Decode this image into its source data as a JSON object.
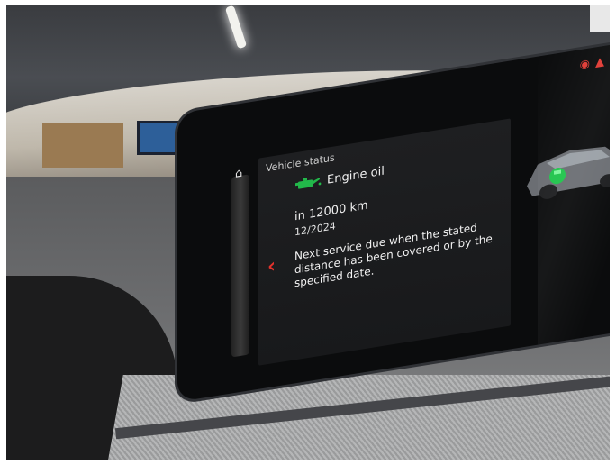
{
  "display": {
    "screen_title": "Vehicle status",
    "home_icon": "home-icon",
    "status_icons": [
      "tire-pressure-icon",
      "warning-icon"
    ],
    "section": {
      "icon": "engine-oil-icon",
      "label": "Engine oil"
    },
    "service": {
      "distance": "in 12000 km",
      "date": "12/2024",
      "description": "Next service due when the stated distance has been covered or by the specified date."
    },
    "back_icon": "back-arrow-icon",
    "vehicle_icon": "car-with-engine-highlight-icon"
  },
  "colors": {
    "accent_red": "#e3322c",
    "oil_green": "#22b84a",
    "text": "#f0f0f0"
  }
}
